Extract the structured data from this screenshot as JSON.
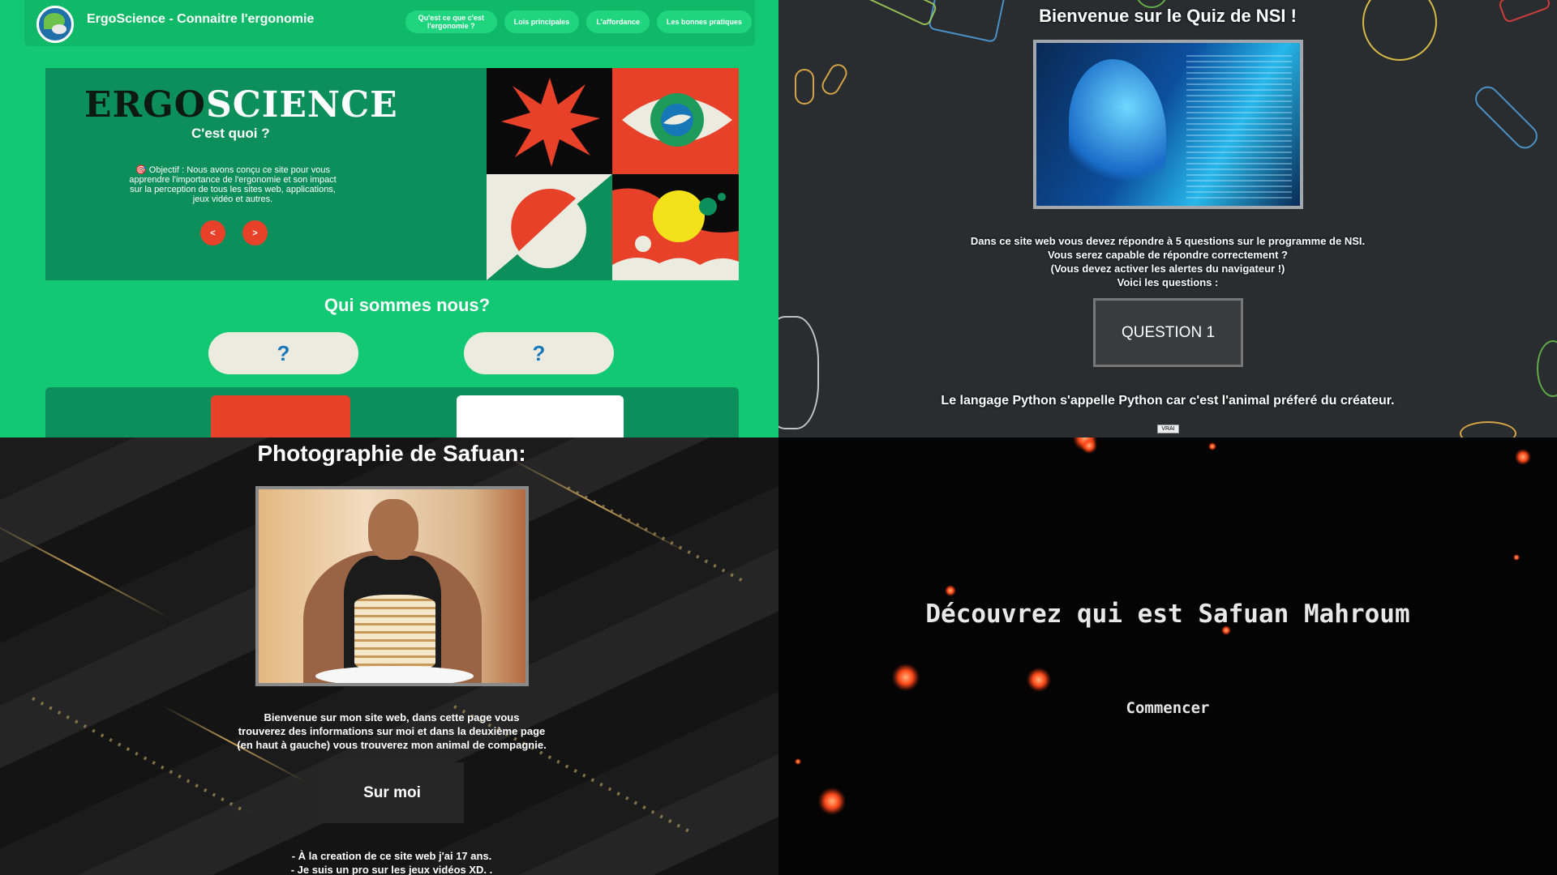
{
  "ergoscience": {
    "title": "ErgoScience - Connaitre l'ergonomie",
    "nav": [
      "Qu'est ce que c'est l'ergonomie ?",
      "Lois principales",
      "L'affordance",
      "Les bonnes pratiques"
    ],
    "hero_word_a": "ERGO",
    "hero_word_b": "SCIENCE",
    "hero_subtitle": "C'est quoi ?",
    "hero_text": "🎯 Objectif : Nous avons conçu ce site pour vous apprendre l'importance de l'ergonomie et son impact sur la perception de tous les sites web, applications, jeux vidéo et autres.",
    "prev_label": "<",
    "next_label": ">",
    "who_title": "Qui sommes nous?",
    "member_1": "?",
    "member_2": "?",
    "colors": {
      "bg": "#12c873",
      "panel": "#0d8f5c",
      "accent": "#e8412a"
    }
  },
  "quiz": {
    "title": "Bienvenue sur le Quiz de NSI !",
    "intro": [
      "Dans ce site web vous devez répondre à 5 questions sur le programme de NSI.",
      "Vous serez capable de répondre correctement ?",
      "(Vous devez activer les alertes du navigateur !)",
      "Voici les questions :"
    ],
    "question_button": "QUESTION 1",
    "question_text": "Le langage Python s'appelle Python car c'est l'animal préferé du créateur.",
    "true_button": "VRAI"
  },
  "photo": {
    "title": "Photographie de Safuan:",
    "intro": [
      "Bienvenue sur mon site web, dans cette page vous",
      "trouverez des informations sur moi et dans la deuxième page",
      "(en haut à gauche) vous trouverez mon animal de compagnie."
    ],
    "button": "Sur moi",
    "facts": [
      "- À la creation de ce site web j'ai 17 ans.",
      "- Je suis un pro sur les jeux vidéos XD. ."
    ]
  },
  "discover": {
    "title": "Découvrez qui est Safuan Mahroum",
    "start_button": "Commencer"
  }
}
